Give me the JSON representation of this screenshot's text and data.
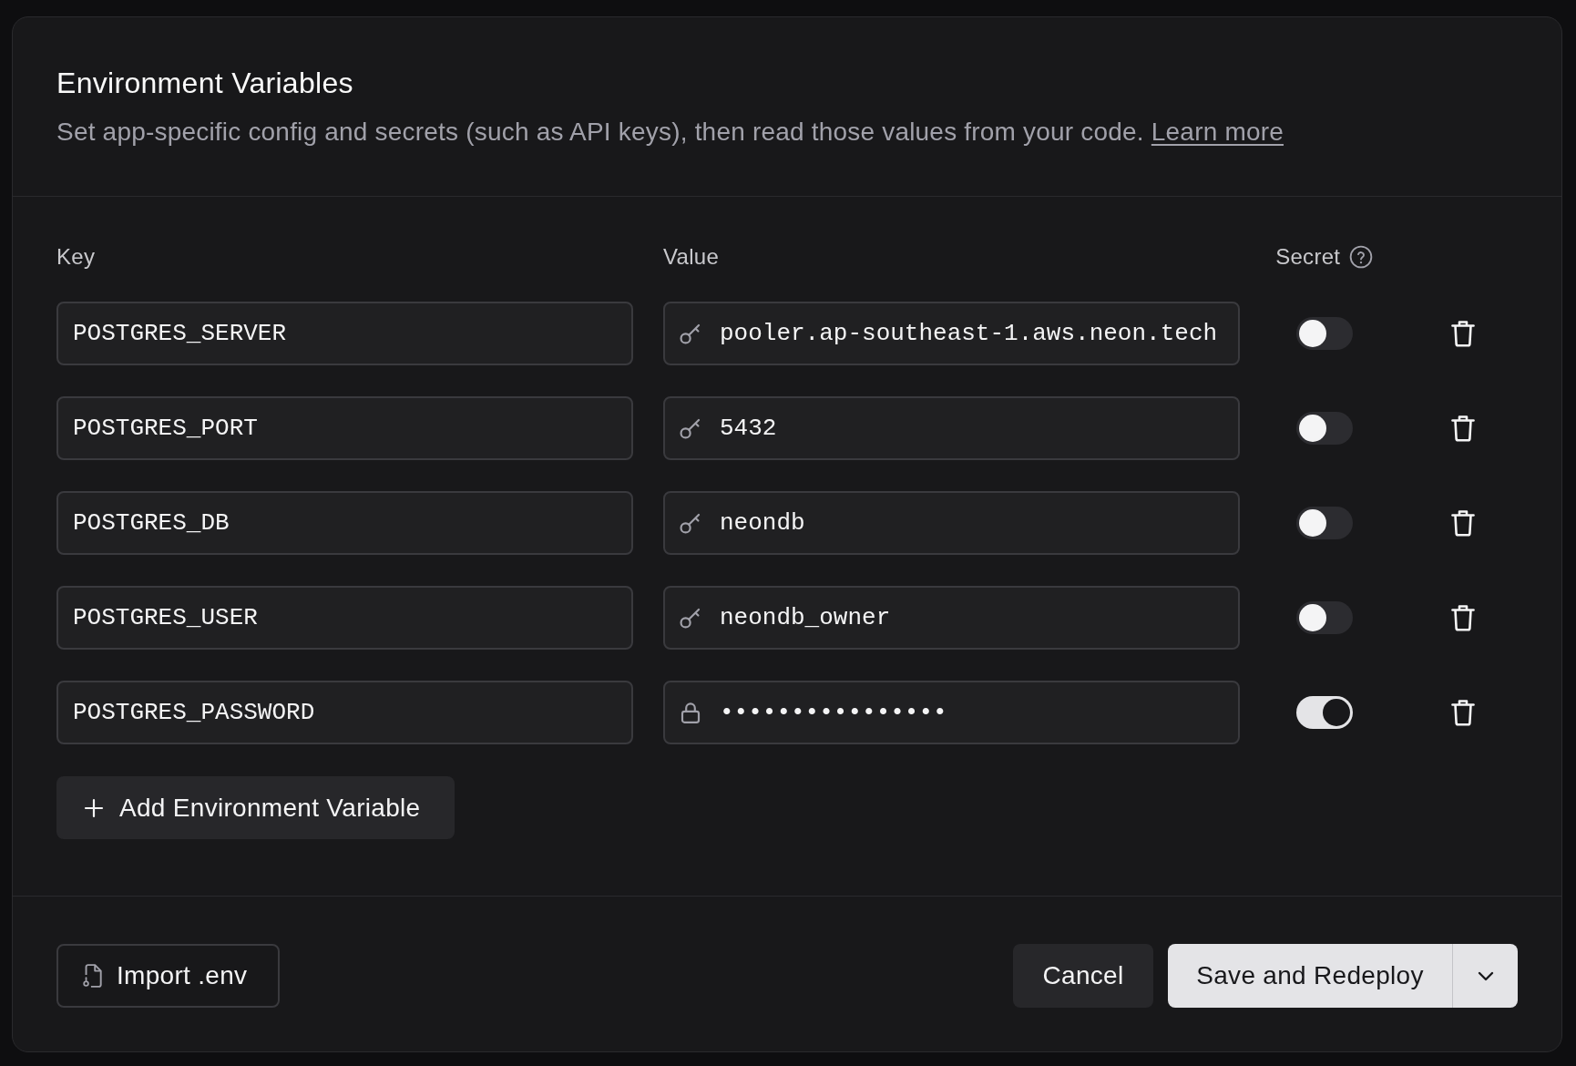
{
  "dialog": {
    "title": "Environment Variables",
    "description": "Set app-specific config and secrets (such as API keys), then read those values from your code.",
    "learn_more_link": "Learn more"
  },
  "columns": {
    "key": "Key",
    "value": "Value",
    "secret": "Secret"
  },
  "variables": [
    {
      "key": "POSTGRES_SERVER",
      "value": "pooler.ap-southeast-1.aws.neon.tech",
      "secret": false
    },
    {
      "key": "POSTGRES_PORT",
      "value": "5432",
      "secret": false
    },
    {
      "key": "POSTGRES_DB",
      "value": "neondb",
      "secret": false
    },
    {
      "key": "POSTGRES_USER",
      "value": "neondb_owner",
      "secret": false
    },
    {
      "key": "POSTGRES_PASSWORD",
      "value": "••••••••••••••••",
      "secret": true
    }
  ],
  "add_button": "Add Environment Variable",
  "footer": {
    "import_button": "Import .env",
    "cancel_button": "Cancel",
    "save_button": "Save and Redeploy"
  }
}
